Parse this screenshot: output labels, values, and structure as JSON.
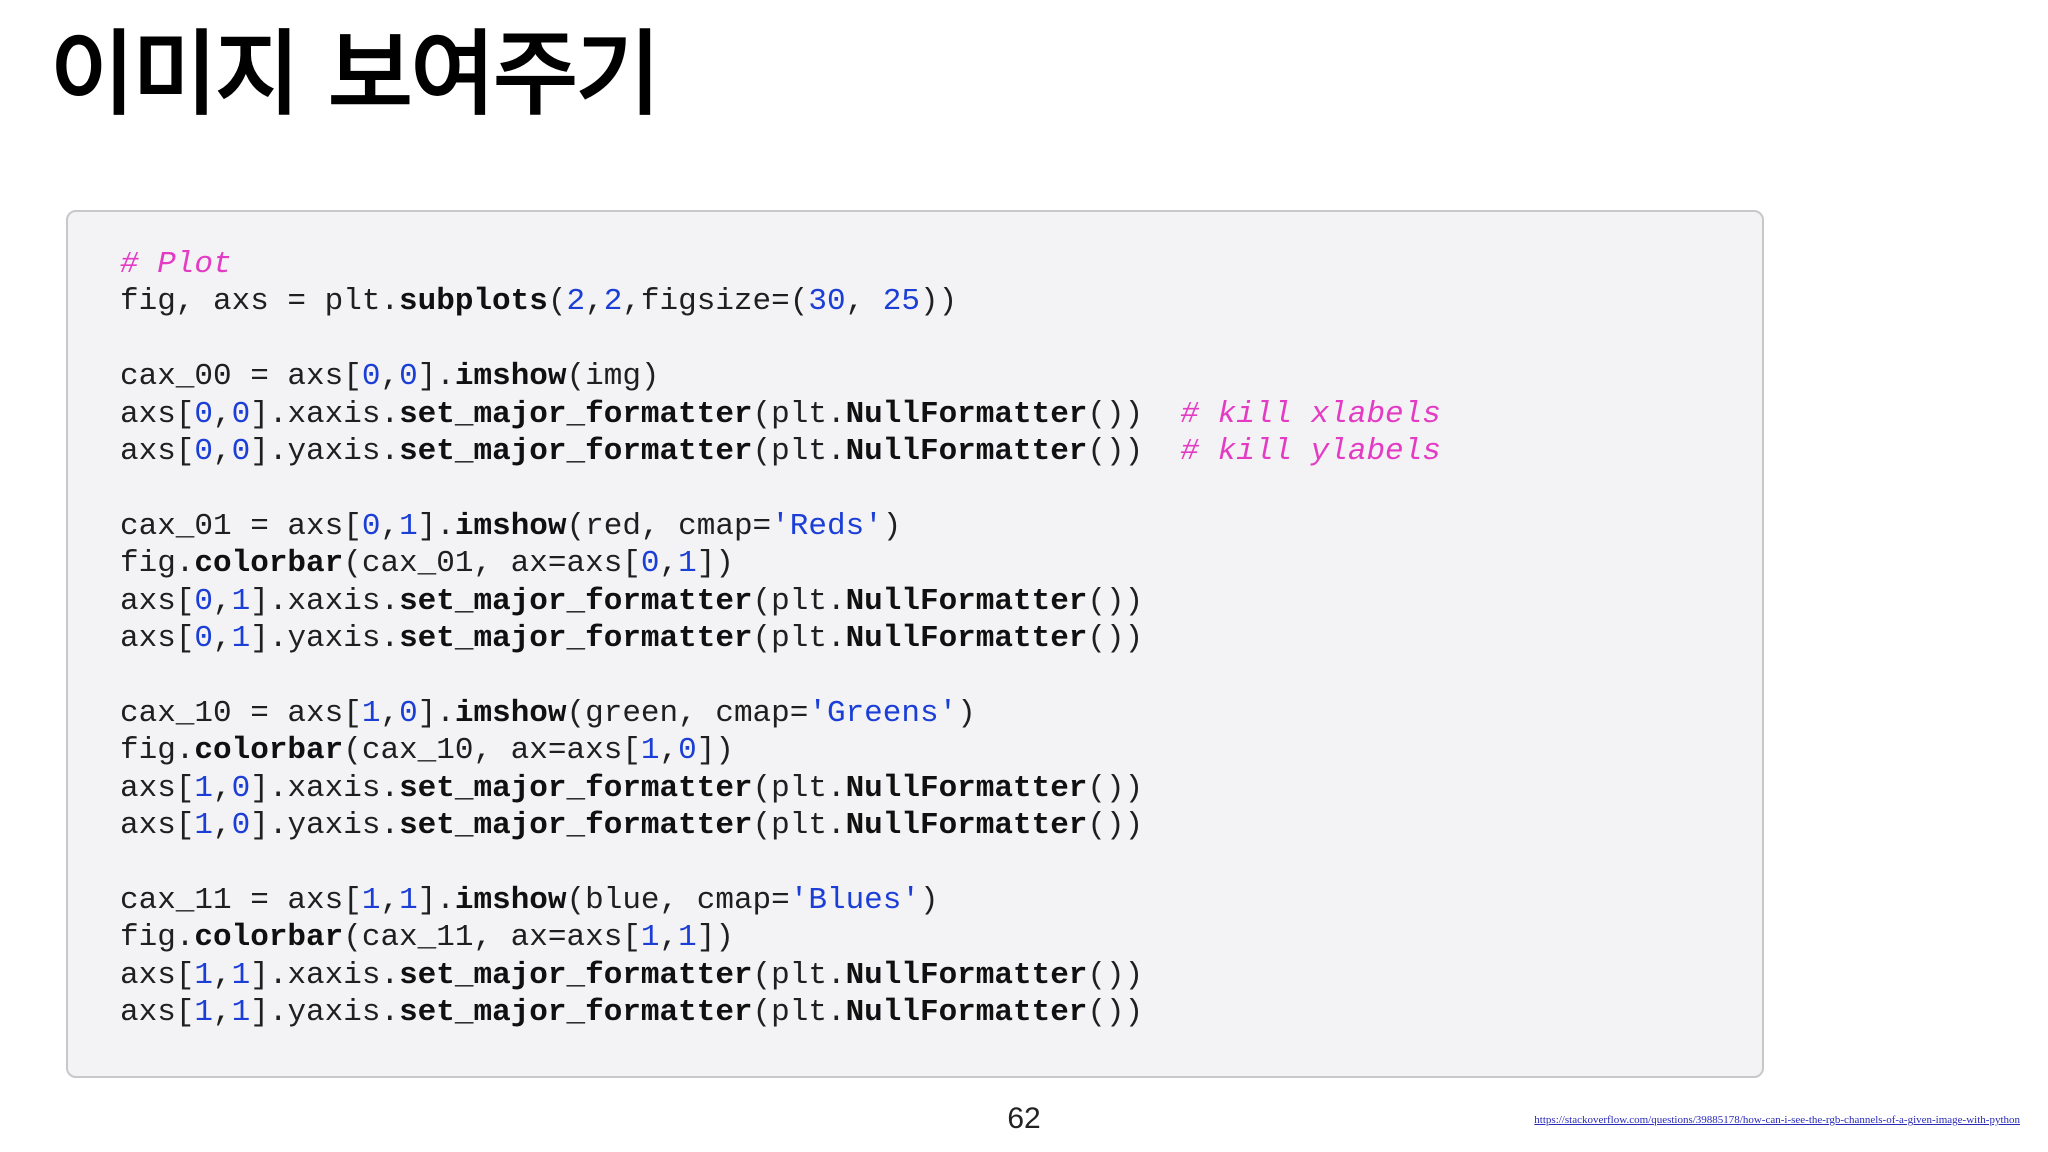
{
  "slide": {
    "title": "이미지 보여주기",
    "page_number": "62",
    "source_url": "https://stackoverflow.com/questions/39885178/how-can-i-see-the-rgb-channels-of-a-given-image-with-python"
  },
  "colors": {
    "comment": "#e43bc4",
    "number_string": "#1b3fd6",
    "code_background": "#f3f2f4",
    "code_border": "#c8c8cb"
  },
  "code": {
    "lines": [
      [
        {
          "t": "cm",
          "v": "# Plot"
        }
      ],
      [
        {
          "t": "p",
          "v": "fig, axs = plt."
        },
        {
          "t": "fn",
          "v": "subplots"
        },
        {
          "t": "p",
          "v": "("
        },
        {
          "t": "num",
          "v": "2"
        },
        {
          "t": "p",
          "v": ","
        },
        {
          "t": "num",
          "v": "2"
        },
        {
          "t": "p",
          "v": ",figsize=("
        },
        {
          "t": "num",
          "v": "30"
        },
        {
          "t": "p",
          "v": ", "
        },
        {
          "t": "num",
          "v": "25"
        },
        {
          "t": "p",
          "v": "))"
        }
      ],
      [],
      [
        {
          "t": "p",
          "v": "cax_00 = axs["
        },
        {
          "t": "num",
          "v": "0"
        },
        {
          "t": "p",
          "v": ","
        },
        {
          "t": "num",
          "v": "0"
        },
        {
          "t": "p",
          "v": "]."
        },
        {
          "t": "fn",
          "v": "imshow"
        },
        {
          "t": "p",
          "v": "(img)"
        }
      ],
      [
        {
          "t": "p",
          "v": "axs["
        },
        {
          "t": "num",
          "v": "0"
        },
        {
          "t": "p",
          "v": ","
        },
        {
          "t": "num",
          "v": "0"
        },
        {
          "t": "p",
          "v": "].xaxis."
        },
        {
          "t": "fn",
          "v": "set_major_formatter"
        },
        {
          "t": "p",
          "v": "(plt."
        },
        {
          "t": "fn",
          "v": "NullFormatter"
        },
        {
          "t": "p",
          "v": "())  "
        },
        {
          "t": "cm",
          "v": "# kill xlabels"
        }
      ],
      [
        {
          "t": "p",
          "v": "axs["
        },
        {
          "t": "num",
          "v": "0"
        },
        {
          "t": "p",
          "v": ","
        },
        {
          "t": "num",
          "v": "0"
        },
        {
          "t": "p",
          "v": "].yaxis."
        },
        {
          "t": "fn",
          "v": "set_major_formatter"
        },
        {
          "t": "p",
          "v": "(plt."
        },
        {
          "t": "fn",
          "v": "NullFormatter"
        },
        {
          "t": "p",
          "v": "())  "
        },
        {
          "t": "cm",
          "v": "# kill ylabels"
        }
      ],
      [],
      [
        {
          "t": "p",
          "v": "cax_01 = axs["
        },
        {
          "t": "num",
          "v": "0"
        },
        {
          "t": "p",
          "v": ","
        },
        {
          "t": "num",
          "v": "1"
        },
        {
          "t": "p",
          "v": "]."
        },
        {
          "t": "fn",
          "v": "imshow"
        },
        {
          "t": "p",
          "v": "(red, cmap="
        },
        {
          "t": "str",
          "v": "'Reds'"
        },
        {
          "t": "p",
          "v": ")"
        }
      ],
      [
        {
          "t": "p",
          "v": "fig."
        },
        {
          "t": "fn",
          "v": "colorbar"
        },
        {
          "t": "p",
          "v": "(cax_01, ax=axs["
        },
        {
          "t": "num",
          "v": "0"
        },
        {
          "t": "p",
          "v": ","
        },
        {
          "t": "num",
          "v": "1"
        },
        {
          "t": "p",
          "v": "])"
        }
      ],
      [
        {
          "t": "p",
          "v": "axs["
        },
        {
          "t": "num",
          "v": "0"
        },
        {
          "t": "p",
          "v": ","
        },
        {
          "t": "num",
          "v": "1"
        },
        {
          "t": "p",
          "v": "].xaxis."
        },
        {
          "t": "fn",
          "v": "set_major_formatter"
        },
        {
          "t": "p",
          "v": "(plt."
        },
        {
          "t": "fn",
          "v": "NullFormatter"
        },
        {
          "t": "p",
          "v": "())"
        }
      ],
      [
        {
          "t": "p",
          "v": "axs["
        },
        {
          "t": "num",
          "v": "0"
        },
        {
          "t": "p",
          "v": ","
        },
        {
          "t": "num",
          "v": "1"
        },
        {
          "t": "p",
          "v": "].yaxis."
        },
        {
          "t": "fn",
          "v": "set_major_formatter"
        },
        {
          "t": "p",
          "v": "(plt."
        },
        {
          "t": "fn",
          "v": "NullFormatter"
        },
        {
          "t": "p",
          "v": "())"
        }
      ],
      [],
      [
        {
          "t": "p",
          "v": "cax_10 = axs["
        },
        {
          "t": "num",
          "v": "1"
        },
        {
          "t": "p",
          "v": ","
        },
        {
          "t": "num",
          "v": "0"
        },
        {
          "t": "p",
          "v": "]."
        },
        {
          "t": "fn",
          "v": "imshow"
        },
        {
          "t": "p",
          "v": "(green, cmap="
        },
        {
          "t": "str",
          "v": "'Greens'"
        },
        {
          "t": "p",
          "v": ")"
        }
      ],
      [
        {
          "t": "p",
          "v": "fig."
        },
        {
          "t": "fn",
          "v": "colorbar"
        },
        {
          "t": "p",
          "v": "(cax_10, ax=axs["
        },
        {
          "t": "num",
          "v": "1"
        },
        {
          "t": "p",
          "v": ","
        },
        {
          "t": "num",
          "v": "0"
        },
        {
          "t": "p",
          "v": "])"
        }
      ],
      [
        {
          "t": "p",
          "v": "axs["
        },
        {
          "t": "num",
          "v": "1"
        },
        {
          "t": "p",
          "v": ","
        },
        {
          "t": "num",
          "v": "0"
        },
        {
          "t": "p",
          "v": "].xaxis."
        },
        {
          "t": "fn",
          "v": "set_major_formatter"
        },
        {
          "t": "p",
          "v": "(plt."
        },
        {
          "t": "fn",
          "v": "NullFormatter"
        },
        {
          "t": "p",
          "v": "())"
        }
      ],
      [
        {
          "t": "p",
          "v": "axs["
        },
        {
          "t": "num",
          "v": "1"
        },
        {
          "t": "p",
          "v": ","
        },
        {
          "t": "num",
          "v": "0"
        },
        {
          "t": "p",
          "v": "].yaxis."
        },
        {
          "t": "fn",
          "v": "set_major_formatter"
        },
        {
          "t": "p",
          "v": "(plt."
        },
        {
          "t": "fn",
          "v": "NullFormatter"
        },
        {
          "t": "p",
          "v": "())"
        }
      ],
      [],
      [
        {
          "t": "p",
          "v": "cax_11 = axs["
        },
        {
          "t": "num",
          "v": "1"
        },
        {
          "t": "p",
          "v": ","
        },
        {
          "t": "num",
          "v": "1"
        },
        {
          "t": "p",
          "v": "]."
        },
        {
          "t": "fn",
          "v": "imshow"
        },
        {
          "t": "p",
          "v": "(blue, cmap="
        },
        {
          "t": "str",
          "v": "'Blues'"
        },
        {
          "t": "p",
          "v": ")"
        }
      ],
      [
        {
          "t": "p",
          "v": "fig."
        },
        {
          "t": "fn",
          "v": "colorbar"
        },
        {
          "t": "p",
          "v": "(cax_11, ax=axs["
        },
        {
          "t": "num",
          "v": "1"
        },
        {
          "t": "p",
          "v": ","
        },
        {
          "t": "num",
          "v": "1"
        },
        {
          "t": "p",
          "v": "])"
        }
      ],
      [
        {
          "t": "p",
          "v": "axs["
        },
        {
          "t": "num",
          "v": "1"
        },
        {
          "t": "p",
          "v": ","
        },
        {
          "t": "num",
          "v": "1"
        },
        {
          "t": "p",
          "v": "].xaxis."
        },
        {
          "t": "fn",
          "v": "set_major_formatter"
        },
        {
          "t": "p",
          "v": "(plt."
        },
        {
          "t": "fn",
          "v": "NullFormatter"
        },
        {
          "t": "p",
          "v": "())"
        }
      ],
      [
        {
          "t": "p",
          "v": "axs["
        },
        {
          "t": "num",
          "v": "1"
        },
        {
          "t": "p",
          "v": ","
        },
        {
          "t": "num",
          "v": "1"
        },
        {
          "t": "p",
          "v": "].yaxis."
        },
        {
          "t": "fn",
          "v": "set_major_formatter"
        },
        {
          "t": "p",
          "v": "(plt."
        },
        {
          "t": "fn",
          "v": "NullFormatter"
        },
        {
          "t": "p",
          "v": "())"
        }
      ]
    ]
  }
}
